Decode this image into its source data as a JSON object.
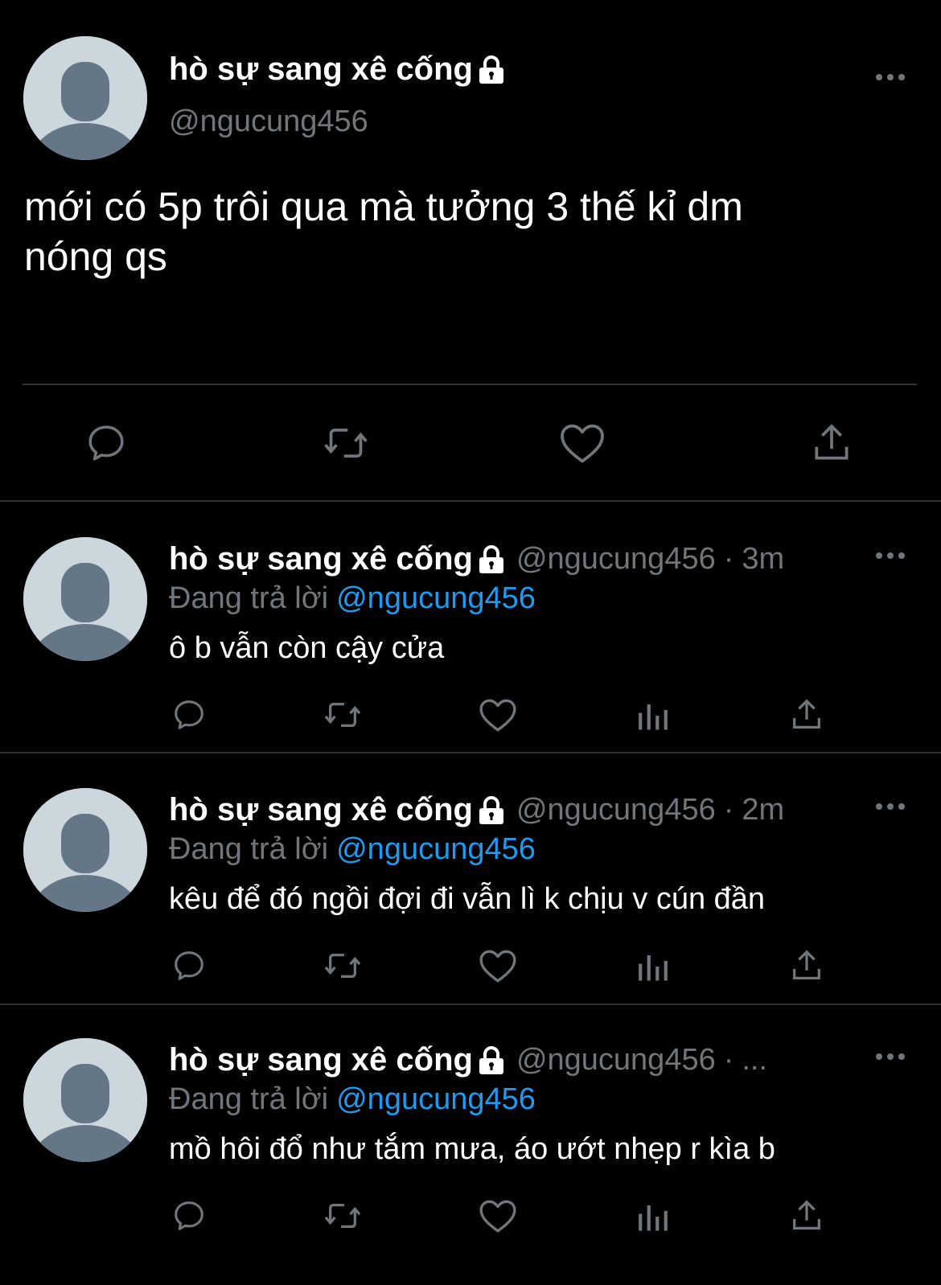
{
  "main_tweet": {
    "display_name": "hò sự sang xê cống",
    "protected_icon": "lock-icon",
    "handle": "@ngucung456",
    "text_line1": "mới có 5p trôi qua mà tưởng 3 thế kỉ dm",
    "text_line2": "nóng qs",
    "actions": [
      "reply-icon",
      "retweet-icon",
      "like-icon",
      "share-icon"
    ]
  },
  "replies": [
    {
      "display_name": "hò sự sang xê cống",
      "handle": "@ngucung456",
      "separator": "·",
      "time": "3m",
      "replying_label": "Đang trả lời",
      "replying_to": "@ngucung456",
      "text": "ô b vẫn còn cậy cửa"
    },
    {
      "display_name": "hò sự sang xê cống",
      "handle": "@ngucung456",
      "separator": "·",
      "time": "2m",
      "replying_label": "Đang trả lời",
      "replying_to": "@ngucung456",
      "text": "kêu để đó ngồi đợi đi vẫn lì k chịu v cún đần"
    },
    {
      "display_name": "hò sự sang xê cống",
      "handle": "@ngucung456",
      "separator": "·",
      "time": "...",
      "replying_label": "Đang trả lời",
      "replying_to": "@ngucung456",
      "text": "mồ hôi đổ như tắm mưa, áo ướt nhẹp r kìa b"
    }
  ],
  "reply_actions": [
    "reply-icon",
    "retweet-icon",
    "like-icon",
    "analytics-icon",
    "share-icon"
  ],
  "colors": {
    "background": "#000000",
    "text_primary": "#ffffff",
    "text_secondary": "#71767b",
    "accent": "#1d9bf0",
    "divider": "#2f3336",
    "avatar_bg": "#ccd6dd",
    "avatar_fg": "#657786"
  }
}
